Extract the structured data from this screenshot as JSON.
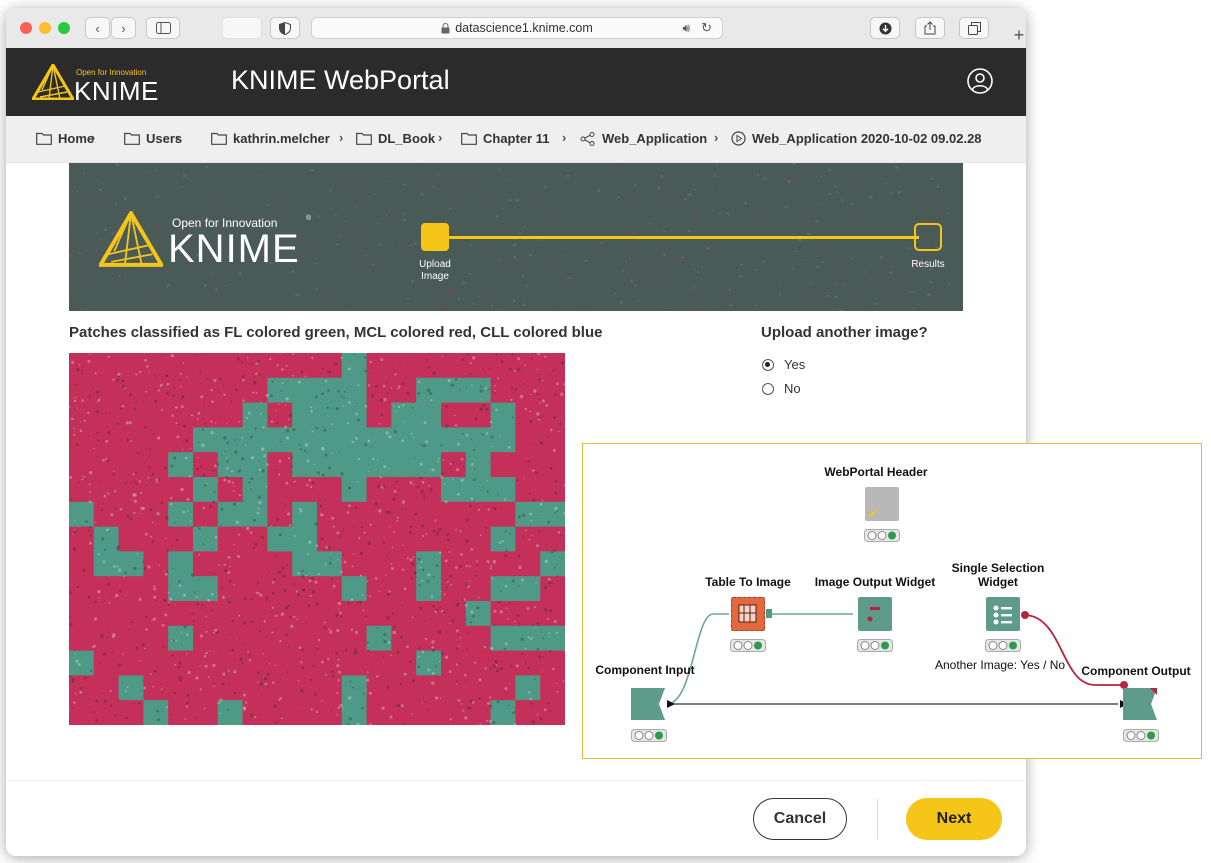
{
  "browser": {
    "url": "datascience1.knime.com"
  },
  "header": {
    "logo_tagline": "Open for Innovation",
    "logo_word": "KNIME",
    "title": "KNIME WebPortal"
  },
  "breadcrumb": [
    {
      "label": "Home",
      "icon": "folder-icon"
    },
    {
      "label": "Users",
      "icon": "folder-icon"
    },
    {
      "label": "kathrin.melcher",
      "icon": "folder-icon"
    },
    {
      "label": "DL_Book",
      "icon": "folder-icon"
    },
    {
      "label": "Chapter 11",
      "icon": "folder-icon"
    },
    {
      "label": "Web_Application",
      "icon": "workflow-icon"
    },
    {
      "label": "Web_Application 2020-10-02 09.02.28",
      "icon": "play-circle-icon"
    }
  ],
  "banner": {
    "tagline": "Open for Innovation",
    "logo_word": "KNIME",
    "step1_line1": "Upload",
    "step1_line2": "Image",
    "step2": "Results",
    "accent": "#f5c518"
  },
  "results": {
    "title": "Patches classified as FL colored green, MCL colored red, CLL colored blue"
  },
  "upload": {
    "question": "Upload another image?",
    "options": [
      "Yes",
      "No"
    ],
    "selected": "Yes"
  },
  "footer": {
    "cancel": "Cancel",
    "next": "Next"
  },
  "workflow": {
    "header_node": "WebPortal Header",
    "table_to_image": "Table To Image",
    "image_output": "Image Output Widget",
    "single_selection_l1": "Single Selection",
    "single_selection_l2": "Widget",
    "component_input": "Component Input",
    "component_output": "Component Output",
    "annotation": "Another Image: Yes / No"
  },
  "colors": {
    "header_bg": "#2b2b2b",
    "patch_red": "#c4305a",
    "patch_green": "#4f9a86",
    "button_yellow": "#f5c518"
  }
}
